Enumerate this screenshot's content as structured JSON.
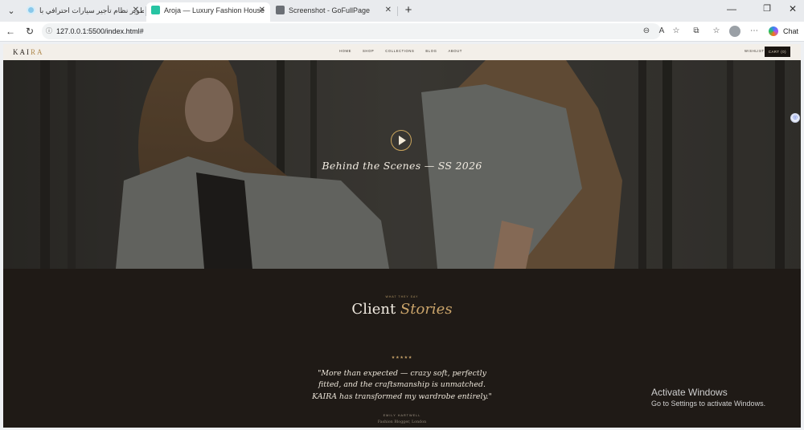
{
  "browser": {
    "tabs": [
      {
        "title": "تطوير نظام تأجير سيارات احترافي با...",
        "active": false,
        "favicon_color": "#89c8ea"
      },
      {
        "title": "Aroja — Luxury Fashion House",
        "active": true,
        "favicon_color": "#27c4a3"
      },
      {
        "title": "Screenshot - GoFullPage",
        "active": false,
        "favicon_color": "#6b6f75"
      }
    ],
    "url": "127.0.0.1:5500/index.html#",
    "chat_label": "Chat",
    "icons": {
      "tabs_menu": "chevron-down-icon",
      "back": "back-arrow-icon",
      "reload": "reload-icon",
      "lock": "info-icon",
      "zoom": "zoom-icon",
      "read_aloud": "read-aloud-icon",
      "favorite": "star-icon",
      "extensions": "puzzle-icon",
      "favorites_bar": "favorites-icon",
      "more": "more-icon"
    }
  },
  "site": {
    "logo_main": "KAI",
    "logo_accent": "RA",
    "nav": [
      "HOME",
      "SHOP",
      "COLLECTIONS",
      "BLOG",
      "ABOUT"
    ],
    "wishlist": "WISHLIST",
    "cart": "CART (0)",
    "hero_caption": "Behind the Scenes — SS 2026",
    "testimonials": {
      "eyebrow": "WHAT THEY SAY",
      "title_plain": "Client",
      "title_accent": "Stories",
      "stars": "★★★★★",
      "quote": "\"More than expected — crazy soft, perfectly fitted, and the craftsmanship is unmatched. KAIRA has transformed my wardrobe entirely.\"",
      "author": "EMILY HARTWELL",
      "role": "Fashion Blogger, London"
    }
  },
  "os": {
    "activate_title": "Activate Windows",
    "activate_sub": "Go to Settings to activate Windows."
  },
  "colors": {
    "accent_gold": "#caa46a",
    "dark_bg": "#1f1a16",
    "cream_nav": "#f3efe9"
  }
}
